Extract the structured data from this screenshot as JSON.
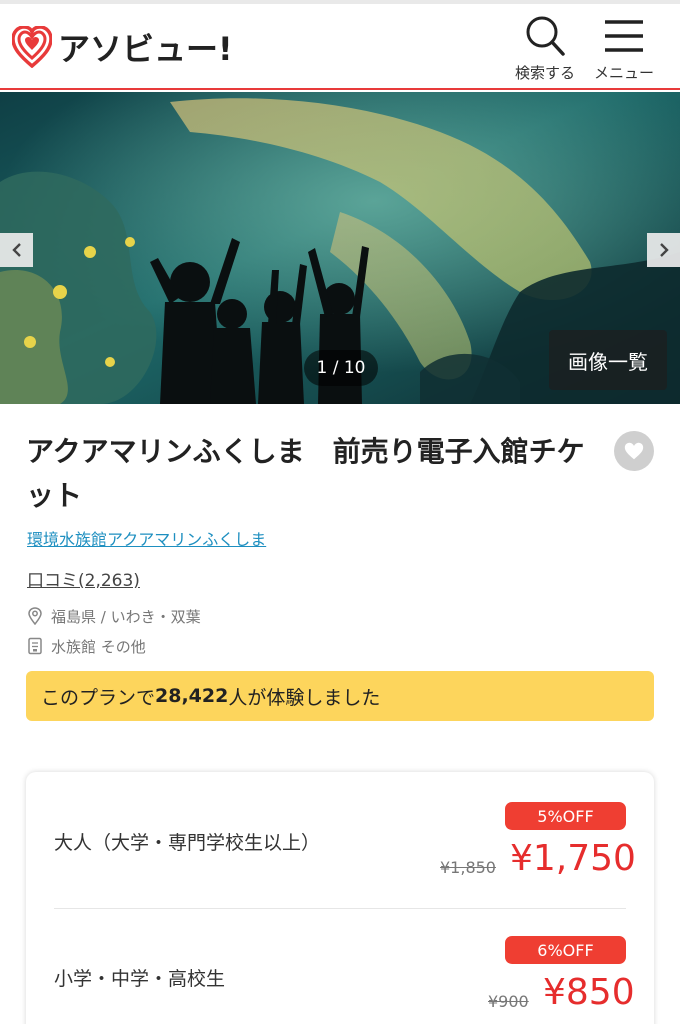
{
  "header": {
    "logo_text": "アソビュー!",
    "search_label": "検索する",
    "menu_label": "メニュー"
  },
  "hero": {
    "counter": "1 / 10",
    "gallery_label": "画像一覧"
  },
  "product": {
    "title": "アクアマリンふくしま　前売り電子入館チケット",
    "facility": "環境水族館アクアマリンふくしま",
    "reviews": "口コミ(2,263)",
    "location": "福島県 / いわき・双葉",
    "category": "水族館 その他"
  },
  "banner": {
    "prefix": "このプランで",
    "count": "28,422",
    "suffix": "人が体験しました"
  },
  "prices": [
    {
      "label": "大人（大学・専門学校生以上）",
      "badge": "5%OFF",
      "old": "¥1,850",
      "new": "¥1,750"
    },
    {
      "label": "小学・中学・高校生",
      "badge": "6%OFF",
      "old": "¥900",
      "new": "¥850"
    }
  ],
  "colors": {
    "brand_red": "#e83a3a",
    "price_red": "#e62d2d",
    "badge_red": "#ef3e32",
    "banner_yellow": "#fdd55c",
    "link_blue": "#1e8fc0"
  }
}
